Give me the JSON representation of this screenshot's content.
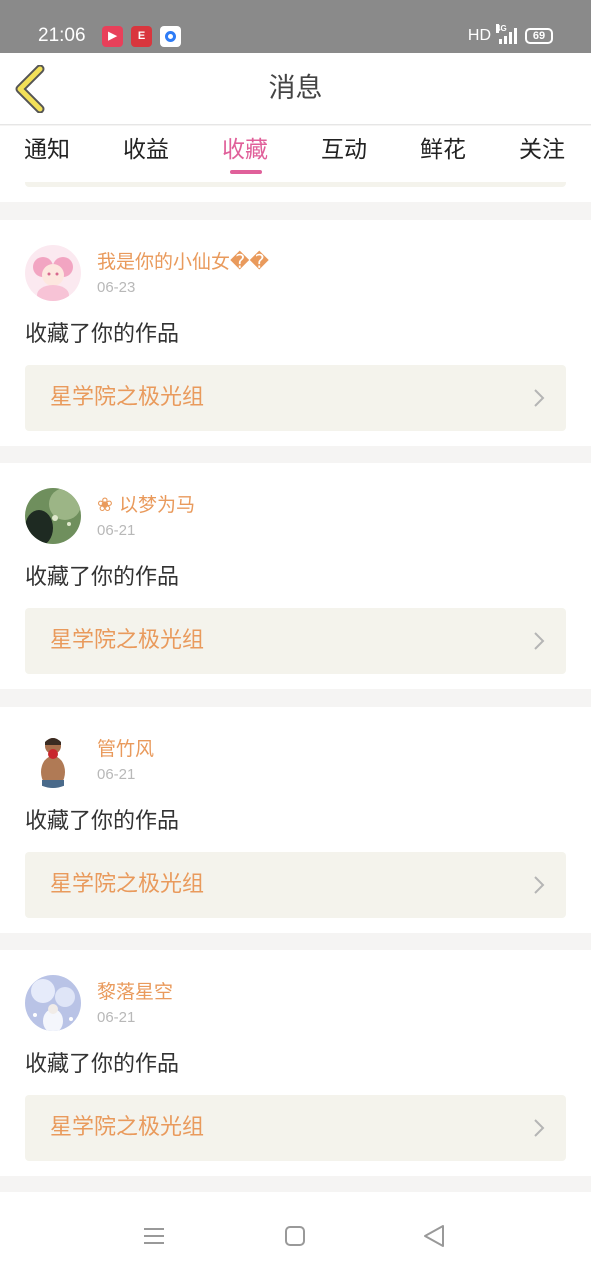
{
  "status_bar": {
    "time": "21:06",
    "app1_label": "▶",
    "app2_label": "E",
    "network_label": "HD",
    "signal_label": "4G",
    "battery": "69"
  },
  "header": {
    "title": "消息"
  },
  "tabs": [
    {
      "label": "通知",
      "active": false
    },
    {
      "label": "收益",
      "active": false
    },
    {
      "label": "收藏",
      "active": true
    },
    {
      "label": "互动",
      "active": false
    },
    {
      "label": "鲜花",
      "active": false
    },
    {
      "label": "关注",
      "active": false
    }
  ],
  "items": [
    {
      "username": "我是你的小仙女��",
      "date": "06-23",
      "action": "收藏了你的作品",
      "work_title": "星学院之极光组"
    },
    {
      "username": "❀ 以梦为马",
      "date": "06-21",
      "action": "收藏了你的作品",
      "work_title": "星学院之极光组"
    },
    {
      "username": "管竹风",
      "date": "06-21",
      "action": "收藏了你的作品",
      "work_title": "星学院之极光组"
    },
    {
      "username": "黎落星空",
      "date": "06-21",
      "action": "收藏了你的作品",
      "work_title": "星学院之极光组"
    }
  ],
  "icons": {
    "back": "chevron-left-icon",
    "card_arrow": "chevron-right-icon",
    "nav_menu": "menu-icon",
    "nav_home": "home-square-icon",
    "nav_back": "back-triangle-icon"
  },
  "colors": {
    "accent": "#e0609a",
    "name": "#e99a5c",
    "card_bg": "#f4f3ec",
    "back_arrow": "#f2e058"
  }
}
